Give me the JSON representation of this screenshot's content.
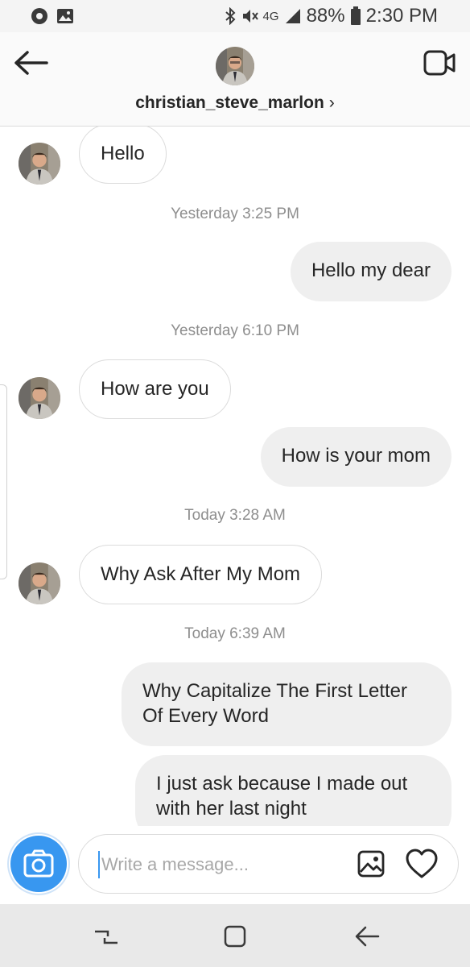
{
  "status_bar": {
    "network": "4G",
    "battery": "88%",
    "time": "2:30 PM",
    "icons": [
      "notification-dot-icon",
      "image-icon",
      "bluetooth-icon",
      "mute-icon",
      "signal-icon",
      "battery-icon"
    ]
  },
  "header": {
    "username": "christian_steve_marlon",
    "chevron": "›",
    "icons": {
      "back": "back-arrow-icon",
      "video": "video-camera-icon"
    }
  },
  "messages": [
    {
      "type": "incoming",
      "text": "Hello"
    },
    {
      "type": "timestamp",
      "text": "Yesterday 3:25 PM"
    },
    {
      "type": "outgoing",
      "text": "Hello my dear"
    },
    {
      "type": "timestamp",
      "text": "Yesterday 6:10 PM"
    },
    {
      "type": "incoming",
      "text": "How are you"
    },
    {
      "type": "outgoing",
      "text": "How is your mom"
    },
    {
      "type": "timestamp",
      "text": "Today 3:28 AM"
    },
    {
      "type": "incoming",
      "text": "Why Ask After My Mom"
    },
    {
      "type": "timestamp",
      "text": "Today 6:39 AM"
    },
    {
      "type": "outgoing",
      "text": "Why Capitalize The First Letter Of Every Word"
    },
    {
      "type": "outgoing",
      "text": "I just ask because I made out with her last night"
    }
  ],
  "composer": {
    "placeholder": "Write a message...",
    "value": "",
    "icons": {
      "camera": "camera-icon",
      "gallery": "gallery-icon",
      "like": "heart-icon"
    }
  },
  "nav_bar": {
    "icons": [
      "recent-apps-icon",
      "home-icon",
      "back-icon"
    ]
  },
  "colors": {
    "accent": "#3897f0",
    "outgoing_bubble": "#efefef",
    "incoming_border": "#dbdbdb",
    "timestamp": "#8e8e8e"
  }
}
